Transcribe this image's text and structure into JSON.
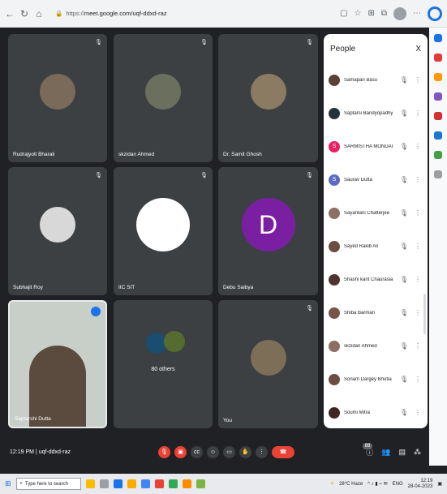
{
  "browser": {
    "url_scheme": "https://",
    "url_rest": "meet.google.com/uqf-ddxd-raz"
  },
  "tiles": [
    {
      "name": "Rudrajyoti Bharali"
    },
    {
      "name": "skzidan Ahmed"
    },
    {
      "name": "Dr. Samit Ghosh"
    },
    {
      "name": "Subhajit Roy"
    },
    {
      "name": "IIC SIT"
    },
    {
      "name": "Debu Saibya",
      "letter": "D"
    },
    {
      "name": "Saptarshi Dutta"
    },
    {
      "name": "80 others"
    },
    {
      "name": "You"
    }
  ],
  "people": {
    "title": "People",
    "close": "X",
    "items": [
      {
        "name": "Samapan Basu",
        "color": "#5d4037"
      },
      {
        "name": "Saptarsi Bandyopadhyay",
        "color": "#263238"
      },
      {
        "name": "SARMISTHA MONDAL",
        "color": "#e91e63",
        "letter": "S"
      },
      {
        "name": "Saurav Dutta",
        "color": "#5c6bc0",
        "letter": "S"
      },
      {
        "name": "Sayantani Chatterjee",
        "color": "#8d6e63"
      },
      {
        "name": "Sayed Rakib Ali",
        "color": "#6d4c41"
      },
      {
        "name": "Shashi kant Chaurasia",
        "color": "#4e342e"
      },
      {
        "name": "Shiba Barman",
        "color": "#795548"
      },
      {
        "name": "skzidan Ahmed",
        "color": "#8d6e63"
      },
      {
        "name": "Sonam Dargey Bhutia",
        "color": "#6d4c41"
      },
      {
        "name": "Soumi Mitra",
        "color": "#3e2723"
      }
    ]
  },
  "meeting": {
    "time": "12:19 PM",
    "separator": "|",
    "code": "uqf-ddxd-raz",
    "people_count": "88"
  },
  "taskbar": {
    "search_placeholder": "Type here to search",
    "weather": "28°C Haze",
    "lang": "ENG",
    "time": "12:19",
    "date": "28-04-2023"
  }
}
